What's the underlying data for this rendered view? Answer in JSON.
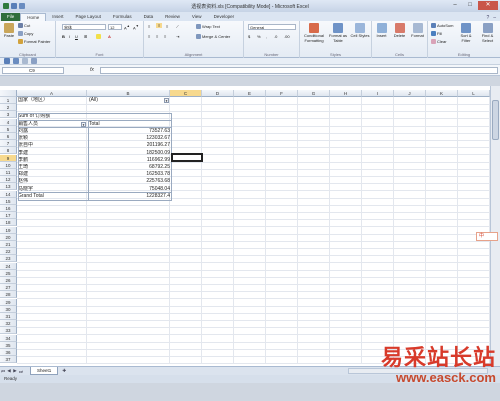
{
  "window": {
    "title": "透视表资料.xls [Compatibility Mode] - Microsoft Excel",
    "min": "–",
    "max": "□",
    "close": "✕"
  },
  "tabs": [
    "File",
    "Home",
    "Insert",
    "Page Layout",
    "Formulas",
    "Data",
    "Review",
    "View",
    "Developer"
  ],
  "ribbon": {
    "paste": "Paste",
    "cut": "Cut",
    "copy": "Copy",
    "format_painter": "Format Painter",
    "clipboard": "Clipboard",
    "font_name": "宋体",
    "font_size": "12",
    "font": "Font",
    "wrap_text": "Wrap Text",
    "merge_center": "Merge & Center",
    "alignment": "Alignment",
    "number_format": "General",
    "number": "Number",
    "conditional": "Conditional Formatting",
    "format_table": "Format as Table",
    "cell_styles": "Cell Styles",
    "styles": "Styles",
    "insert": "Insert",
    "delete": "Delete",
    "format": "Format",
    "cells": "Cells",
    "autosum": "AutoSum",
    "fill": "Fill",
    "clear": "Clear",
    "sort_filter": "Sort & Filter",
    "find_select": "Find & Select",
    "editing": "Editing"
  },
  "formula_bar": {
    "name_box": "C9",
    "fx": "fx",
    "value": ""
  },
  "columns": [
    "A",
    "B",
    "C",
    "D",
    "E",
    "F",
    "G",
    "H",
    "I",
    "J",
    "K",
    "L",
    "M"
  ],
  "rows": [
    "1",
    "2",
    "3",
    "4",
    "5",
    "6",
    "7",
    "8",
    "9",
    "10",
    "11",
    "12",
    "13",
    "14",
    "15",
    "16",
    "17",
    "18",
    "19",
    "20",
    "21",
    "22",
    "23",
    "24",
    "25",
    "26",
    "27",
    "28",
    "29",
    "30",
    "31",
    "32",
    "33",
    "34",
    "35",
    "36",
    "37"
  ],
  "pivot": {
    "filter_label": "国家（地区）",
    "filter_value": "(All)",
    "data_label": "Sum of 订购额",
    "row_label": "销售人员",
    "total_header": "Total",
    "grand_total_label": "Grand Total",
    "grand_total_value": "1228327.4",
    "rows": [
      {
        "name": "刘露",
        "value": "73527.63"
      },
      {
        "name": "张颖",
        "value": "123032.67"
      },
      {
        "name": "张自中",
        "value": "201196.27"
      },
      {
        "name": "李建",
        "value": "182500.09"
      },
      {
        "name": "李鹏",
        "value": "116962.99"
      },
      {
        "name": "王琦",
        "value": "68792.25"
      },
      {
        "name": "郑建",
        "value": "162503.78"
      },
      {
        "name": "赵伟",
        "value": "225763.68"
      },
      {
        "name": "马晓宇",
        "value": "75048.04"
      }
    ]
  },
  "sheet_tab": "Sheet1",
  "status": "Ready",
  "ime_label": "中 ",
  "watermark": {
    "cn": "易采站长站",
    "url": "www.easck.com"
  },
  "colors": {
    "file_tab": "#2f6e3b",
    "selection_header": "#f7d98e",
    "watermark": "#d83a2a"
  }
}
